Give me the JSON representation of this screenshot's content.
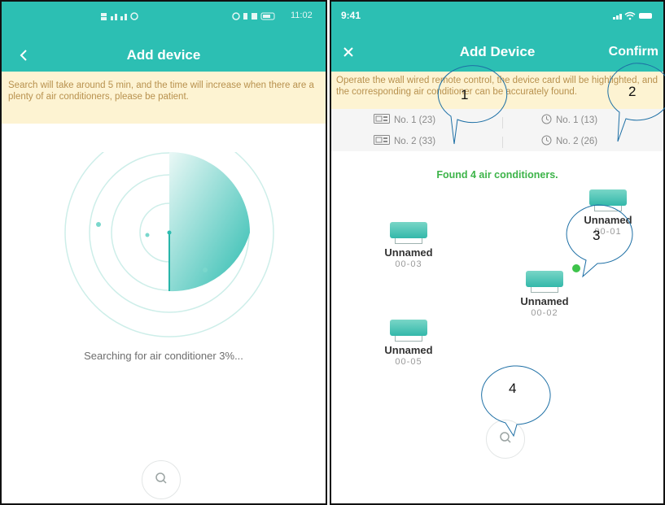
{
  "left_screen": {
    "status_bar": {
      "time": "11:02"
    },
    "title": "Add device",
    "notice": "Search will take around 5 min, and the time will increase when there are a plenty of air conditioners, please be patient.",
    "search_status": "Searching for air conditioner 3%...",
    "progress_percent": 3
  },
  "right_screen": {
    "status_bar": {
      "time": "9:41"
    },
    "title": "Add Device",
    "confirm_label": "Confirm",
    "notice": "Operate the wall wired remote control, the device card will be highlighted, and the corresponding air conditioner can be accurately found.",
    "stats": [
      {
        "icon": "wired-controller-icon",
        "text": "No. 1 (23)"
      },
      {
        "icon": "clock-icon",
        "text": "No. 1 (13)"
      },
      {
        "icon": "wired-controller-icon",
        "text": "No. 2 (33)"
      },
      {
        "icon": "clock-icon",
        "text": "No. 2 (26)"
      }
    ],
    "found_text": "Found 4 air conditioners.",
    "devices": [
      {
        "name": "Unnamed",
        "code": "00-01"
      },
      {
        "name": "Unnamed",
        "code": "00-03"
      },
      {
        "name": "Unnamed",
        "code": "00-02",
        "online": true
      },
      {
        "name": "Unnamed",
        "code": "00-05"
      }
    ]
  },
  "callouts": [
    "1",
    "2",
    "3",
    "4"
  ],
  "colors": {
    "header": "#2cbfb3",
    "notice_bg": "#fdf3d2",
    "notice_text": "#b8914e",
    "found_text": "#3db449",
    "online_dot": "#3ec34b"
  }
}
